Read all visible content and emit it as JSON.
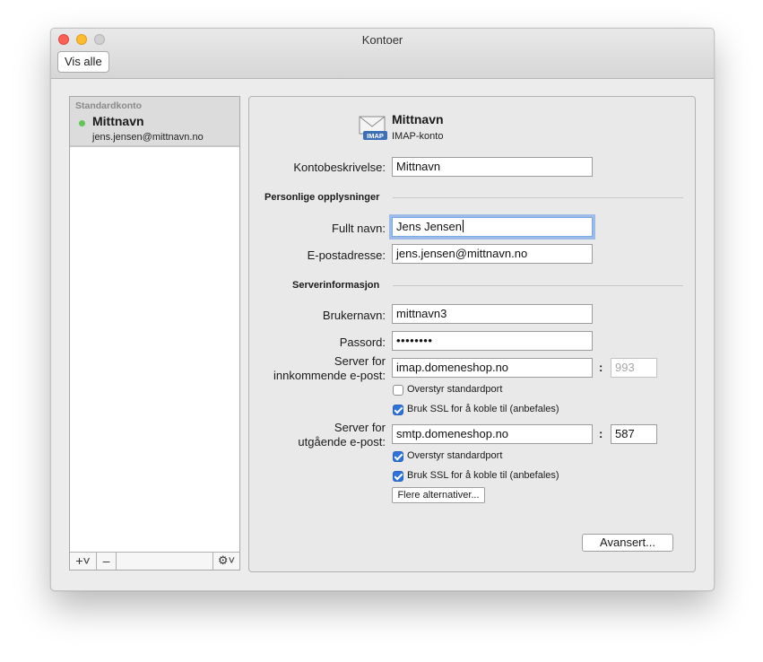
{
  "window": {
    "title": "Kontoer",
    "show_all_label": "Vis alle"
  },
  "sidebar": {
    "group_label": "Standardkonto",
    "accounts": [
      {
        "name": "Mittnavn",
        "email": "jens.jensen@mittnavn.no",
        "status": "online",
        "status_color": "#62c654"
      }
    ],
    "footer": {
      "add_label": "+˅",
      "remove_label": "–",
      "actions_label": "⚙˅"
    }
  },
  "account": {
    "icon": "mail-imap-icon",
    "icon_badge": "IMAP",
    "name": "Mittnavn",
    "type": "IMAP-konto",
    "description_label": "Kontobeskrivelse:",
    "description_value": "Mittnavn"
  },
  "personal": {
    "section_title": "Personlige opplysninger",
    "fullname_label": "Fullt navn:",
    "fullname_value": "Jens Jensen",
    "email_label": "E-postadresse:",
    "email_value": "jens.jensen@mittnavn.no"
  },
  "server": {
    "section_title": "Serverinformasjon",
    "username_label": "Brukernavn:",
    "username_value": "mittnavn3",
    "password_label": "Passord:",
    "password_value": "••••••••",
    "incoming_label_line1": "Server for",
    "incoming_label_line2": "innkommende e-post:",
    "incoming_host": "imap.domeneshop.no",
    "incoming_port": "993",
    "incoming_override_label": "Overstyr standardport",
    "incoming_override_checked": false,
    "incoming_ssl_label": "Bruk SSL for å koble til (anbefales)",
    "incoming_ssl_checked": true,
    "outgoing_label_line1": "Server for",
    "outgoing_label_line2": "utgående e-post:",
    "outgoing_host": "smtp.domeneshop.no",
    "outgoing_port": "587",
    "outgoing_override_label": "Overstyr standardport",
    "outgoing_override_checked": true,
    "outgoing_ssl_label": "Bruk SSL for å koble til (anbefales)",
    "outgoing_ssl_checked": true,
    "more_options_label": "Flere alternativer...",
    "port_separator": ":"
  },
  "advanced_label": "Avansert...",
  "colors": {
    "accent": "#2f74d5",
    "focus_ring": "#7aa7e6"
  }
}
